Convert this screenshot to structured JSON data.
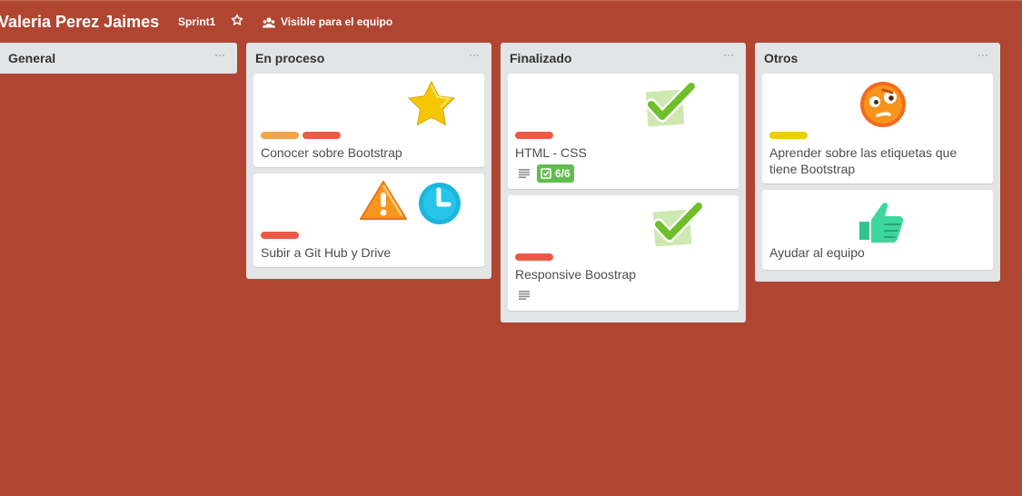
{
  "board": {
    "title": "Valeria Perez Jaimes",
    "sprint_label": "Sprint1",
    "visibility_label": "Visible para el equipo"
  },
  "lists": [
    {
      "title": "General",
      "menu": "···",
      "cards": []
    },
    {
      "title": "En proceso",
      "menu": "···",
      "cards": [
        {
          "title": "Conocer sobre Bootstrap",
          "labels": [
            "#f2a54a",
            "#eb5a46"
          ],
          "stickers": [
            "star-sticker"
          ]
        },
        {
          "title": "Subir a Git Hub y Drive",
          "labels": [
            "#eb5a46"
          ],
          "stickers": [
            "warning-sticker",
            "clock-sticker"
          ]
        }
      ]
    },
    {
      "title": "Finalizado",
      "menu": "···",
      "cards": [
        {
          "title": "HTML - CSS",
          "labels": [
            "#eb5a46"
          ],
          "stickers": [
            "check-sticker"
          ],
          "has_description": true,
          "checklist": "6/6"
        },
        {
          "title": "Responsive Boostrap",
          "labels": [
            "#eb5a46"
          ],
          "stickers": [
            "check-sticker"
          ],
          "has_description": true
        }
      ]
    },
    {
      "title": "Otros",
      "menu": "···",
      "cards": [
        {
          "title": "Aprender sobre las etiquetas que tiene Bootstrap",
          "labels": [
            "#e6d000"
          ],
          "stickers": [
            "confused-face-sticker"
          ]
        },
        {
          "title": "Ayudar al equipo",
          "labels": [],
          "stickers": [
            "thumbs-up-sticker"
          ]
        }
      ]
    }
  ],
  "colors": {
    "board_background": "#b04632",
    "list_background": "#e2e4e6",
    "checklist_complete": "#61bd4f"
  }
}
